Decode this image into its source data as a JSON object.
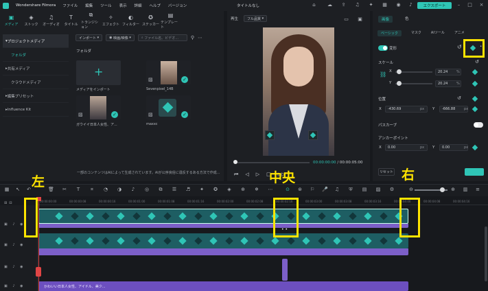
{
  "app": {
    "name": "Wondershare Filmora",
    "doc_title": "タイトルなし",
    "export": "エクスポート"
  },
  "menu": [
    "ファイル",
    "編集",
    "ツール",
    "表示",
    "詳細",
    "ヘルプ",
    "バージョン"
  ],
  "media_tabs": [
    {
      "label": "メディア",
      "icon": "media-icon"
    },
    {
      "label": "ストック",
      "icon": "stock-icon"
    },
    {
      "label": "オーディオ",
      "icon": "audio-icon"
    },
    {
      "label": "タイトル",
      "icon": "title-icon"
    },
    {
      "label": "トランジション",
      "icon": "transition-icon"
    },
    {
      "label": "エフェクト",
      "icon": "effect-icon"
    },
    {
      "label": "フィルター",
      "icon": "filter-icon"
    },
    {
      "label": "ステッカー",
      "icon": "sticker-icon"
    },
    {
      "label": "テンプレート",
      "icon": "template-icon"
    }
  ],
  "sidebar": [
    {
      "label": "プロジェクトメディア"
    },
    {
      "label": "フォルダ"
    },
    {
      "label": "共有メディア"
    },
    {
      "label": "クラウドメディア"
    },
    {
      "label": "編集プリセット"
    },
    {
      "label": "Influence Kit"
    }
  ],
  "media_toolbar": {
    "import": "インポート",
    "filter": "映画/映像",
    "search_placeholder": "ファイル名、ビデオ..."
  },
  "folder_label": "フォルダ",
  "media_items": [
    {
      "caption": "メディアをインポート"
    },
    {
      "caption": "Sevenpixel_14B"
    },
    {
      "caption": "ガウイイ日本人女性、ア..."
    },
    {
      "caption": "maxxc"
    }
  ],
  "media_note": "一部のコンテンツはAIによって生成されています。AIが公序良俗に違反するある方法で作成...",
  "preview": {
    "label": "再生",
    "quality": "フル品質",
    "current_time": "00:00:00:00",
    "separator": "/",
    "total_time": "00:00:05:00"
  },
  "properties": {
    "tabs": [
      "画像",
      "色"
    ],
    "sub_tabs": [
      "ベーシック",
      "マスク",
      "AIツール",
      "アニメ"
    ],
    "transform_label": "変形",
    "scale_label": "スケール",
    "scale_x": "20.24",
    "scale_y": "20.24",
    "scale_unit": "%",
    "position_label": "位置",
    "pos_x": "-430.69",
    "pos_y": "-666.88",
    "pos_unit": "px",
    "blur_label": "パスカーブ",
    "anchor_label": "アンカーポイント",
    "anchor_x": "0.00",
    "anchor_y": "0.00",
    "anchor_unit": "px",
    "reset": "リセット"
  },
  "timeline": {
    "ticks": [
      "00:00:00:00",
      "00:00:00:08",
      "00:00:00:16",
      "00:00:01:00",
      "00:00:01:08",
      "00:00:01:16",
      "00:00:02:00",
      "00:00:02:08",
      "00:00:02:16",
      "00:00:03:00",
      "00:00:03:08",
      "00:00:03:16",
      "00:00:04:00",
      "00:00:04:08",
      "00:00:04:16"
    ],
    "text_clip": "かわいい日本人女性、アイドル、美少..."
  },
  "annotations": {
    "left": "左",
    "center": "中央",
    "right": "右"
  }
}
